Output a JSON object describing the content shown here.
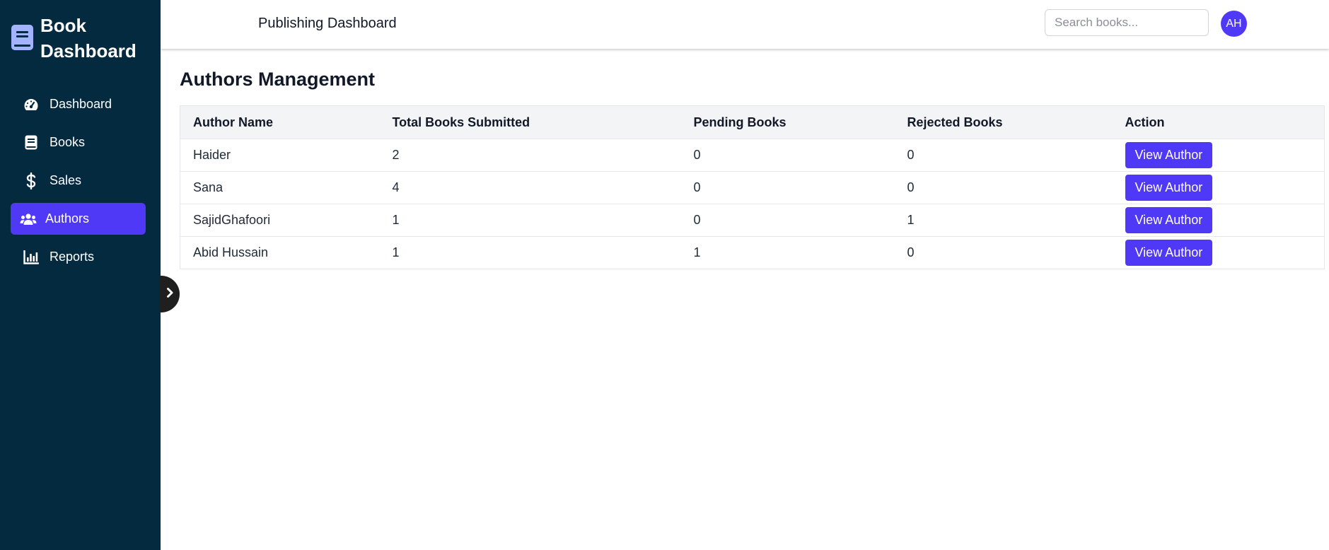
{
  "sidebar": {
    "brand_title": "Book Dashboard",
    "items": [
      {
        "label": "Dashboard",
        "icon": "gauge-icon"
      },
      {
        "label": "Books",
        "icon": "book-icon"
      },
      {
        "label": "Sales",
        "icon": "dollar-icon"
      },
      {
        "label": "Authors",
        "icon": "users-icon",
        "active": true
      },
      {
        "label": "Reports",
        "icon": "chart-bar-icon"
      }
    ]
  },
  "header": {
    "title": "Publishing Dashboard",
    "search_placeholder": "Search books...",
    "avatar_initials": "AH"
  },
  "main": {
    "title": "Authors Management",
    "table": {
      "columns": [
        "Author Name",
        "Total Books Submitted",
        "Pending Books",
        "Rejected Books",
        "Action"
      ],
      "rows": [
        {
          "name": "Haider",
          "total": "2",
          "pending": "0",
          "rejected": "0",
          "action": "View Author"
        },
        {
          "name": "Sana",
          "total": "4",
          "pending": "0",
          "rejected": "0",
          "action": "View Author"
        },
        {
          "name": "SajidGhafoori",
          "total": "1",
          "pending": "0",
          "rejected": "1",
          "action": "View Author"
        },
        {
          "name": "Abid Hussain",
          "total": "1",
          "pending": "1",
          "rejected": "0",
          "action": "View Author"
        }
      ]
    }
  },
  "colors": {
    "sidebar_bg": "#042a40",
    "accent": "#4f39f6",
    "brand_icon": "#a3b3ff"
  }
}
